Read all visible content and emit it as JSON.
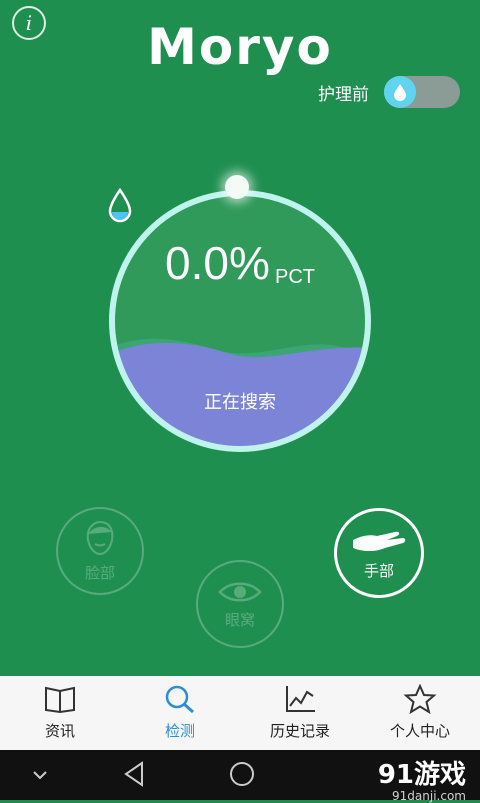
{
  "header": {
    "info_icon": "info-icon",
    "info_glyph": "i",
    "logo": "Moryo",
    "toggle_label": "护理前",
    "toggle_icon": "water-drop-icon"
  },
  "gauge": {
    "value": "0.0%",
    "unit": "PCT",
    "fill_fraction": 0.0,
    "status": "正在搜索",
    "colors": {
      "ring": "#bff3ee",
      "wave": "#7b84d6",
      "wave_back": "#3fa77a",
      "inner": "#2f9a5a"
    }
  },
  "modes": [
    {
      "label": "脸部",
      "icon": "face-icon",
      "active": false
    },
    {
      "label": "眼窝",
      "icon": "eye-icon",
      "active": false
    },
    {
      "label": "手部",
      "icon": "hand-icon",
      "active": true
    }
  ],
  "tabs": [
    {
      "label": "资讯",
      "icon": "book-icon",
      "selected": false
    },
    {
      "label": "检测",
      "icon": "search-icon",
      "selected": true
    },
    {
      "label": "历史记录",
      "icon": "chart-icon",
      "selected": false
    },
    {
      "label": "个人中心",
      "icon": "star-icon",
      "selected": false
    }
  ],
  "system_nav": {
    "buttons": [
      "chevron-down-icon",
      "back-icon",
      "home-icon"
    ],
    "watermark_main": "91游戏",
    "watermark_sub": "91danji.com"
  },
  "colors": {
    "background": "#1f8f50",
    "accent_blue": "#2a8fd6",
    "toggle_knob": "#5fd3f0"
  }
}
